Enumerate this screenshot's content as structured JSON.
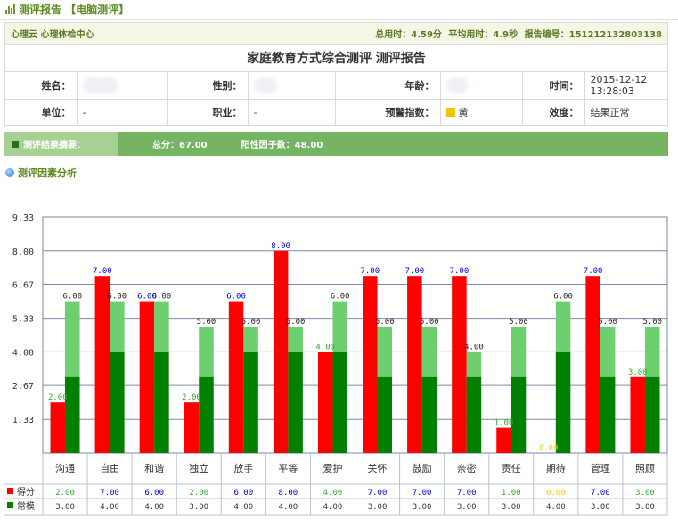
{
  "header": {
    "title": "测评报告 【电脑测评】"
  },
  "info": {
    "org": "心理云 心理体检中心",
    "total_time": "总用时：4.59分",
    "avg_time": "平均用时：4.9秒",
    "report_no": "报告编号：151212132803138",
    "report_title": "家庭教育方式综合测评 测评报告",
    "labels": {
      "name": "姓名：",
      "gender": "性别：",
      "age": "年龄：",
      "time": "时间：",
      "unit": "单位：",
      "job": "职业：",
      "warning": "预警指数：",
      "validity": "效度："
    },
    "values": {
      "time": "2015-12-12 13:28:03",
      "unit": "-",
      "job": "-",
      "warning": "黄",
      "validity": "结果正常"
    }
  },
  "summary": {
    "label": "测评结果摘要：",
    "total": "总分：67.00",
    "positive": "阳性因子数：48.00"
  },
  "factor_title": "测评因素分析",
  "colors": {
    "score": "#ff0000",
    "norm_dark": "#008000",
    "norm_light": "#6dcf6d",
    "score_label": "#0000ff",
    "low_label": "#33aa33",
    "zero_label": "#ffcc00"
  },
  "chart_data": {
    "type": "bar",
    "categories": [
      "沟通",
      "自由",
      "和谐",
      "独立",
      "放手",
      "平等",
      "爱护",
      "关怀",
      "鼓励",
      "亲密",
      "责任",
      "期待",
      "管理",
      "照顾"
    ],
    "series": [
      {
        "name": "得分",
        "values": [
          2,
          7,
          6,
          2,
          6,
          8,
          4,
          7,
          7,
          7,
          1,
          0,
          7,
          3
        ]
      },
      {
        "name": "常模",
        "values": [
          6,
          6,
          6,
          5,
          5,
          5,
          6,
          5,
          5,
          4,
          5,
          6,
          5,
          5
        ]
      }
    ],
    "norm_base": [
      3,
      4,
      4,
      3,
      4,
      4,
      4,
      3,
      3,
      3,
      3,
      4,
      3,
      3
    ],
    "yticks": [
      "1.33",
      "2.67",
      "4.00",
      "5.33",
      "6.67",
      "8.00",
      "9.33"
    ],
    "ylim": [
      0,
      9.33
    ],
    "table_rows": [
      {
        "legend": "得分",
        "values": [
          "2.00",
          "7.00",
          "6.00",
          "2.00",
          "6.00",
          "8.00",
          "4.00",
          "7.00",
          "7.00",
          "7.00",
          "1.00",
          "0.00",
          "7.00",
          "3.00"
        ]
      },
      {
        "legend": "常模",
        "values": [
          "3.00",
          "4.00",
          "4.00",
          "3.00",
          "4.00",
          "4.00",
          "4.00",
          "3.00",
          "3.00",
          "3.00",
          "3.00",
          "4.00",
          "3.00",
          "3.00"
        ]
      }
    ],
    "bar_labels_score": [
      "2.00",
      "7.00",
      "6.00",
      "2.00",
      "6.00",
      "8.00",
      "4.00",
      "7.00",
      "7.00",
      "7.00",
      "1.00",
      "0.00",
      "7.00",
      "3.00"
    ],
    "bar_labels_norm": [
      "6.00",
      "6.00",
      "6.00",
      "5.00",
      "5.00",
      "5.00",
      "6.00",
      "5.00",
      "5.00",
      "4.00",
      "5.00",
      "6.00",
      "5.00",
      "5.00"
    ]
  }
}
